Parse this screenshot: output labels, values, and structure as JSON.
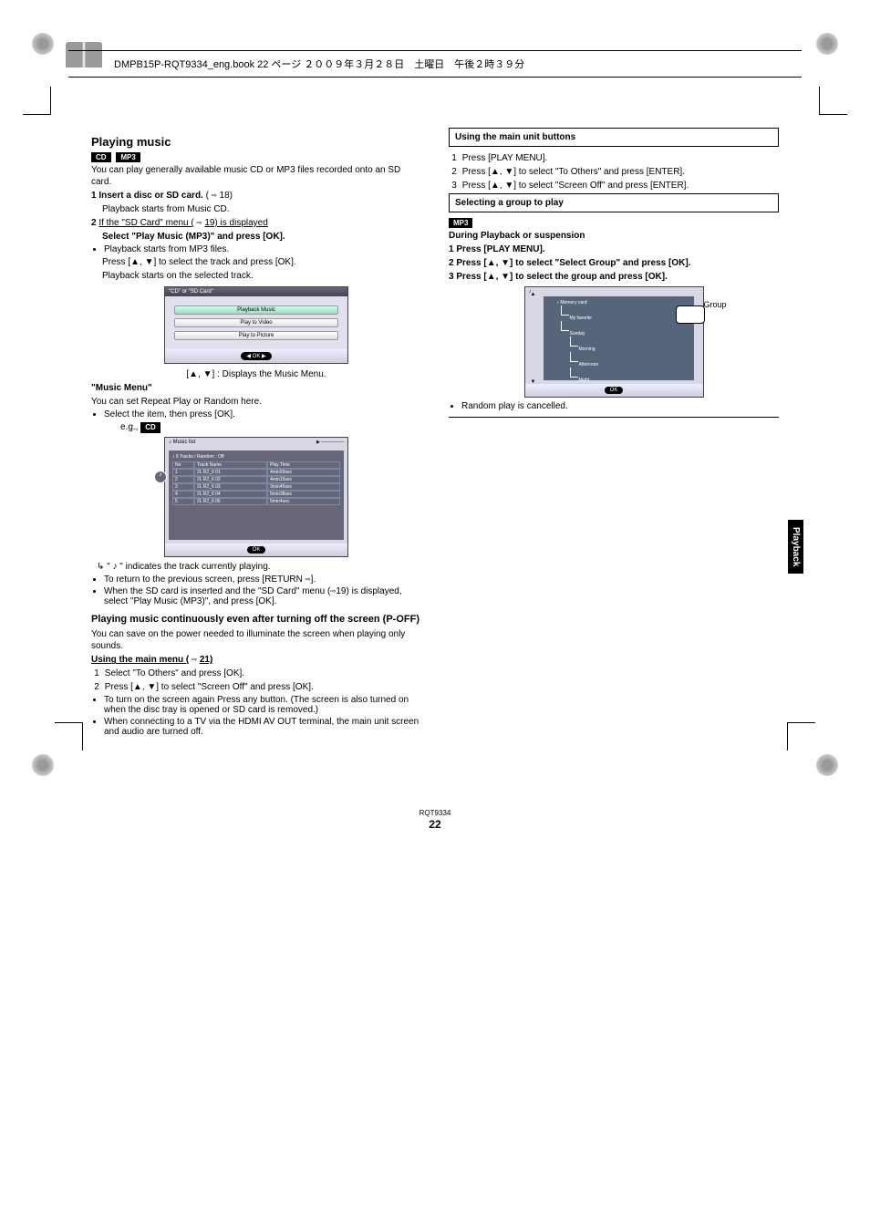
{
  "header": "DMPB15P-RQT9334_eng.book  22 ページ  ２００９年３月２８日　土曜日　午後２時３９分",
  "left": {
    "title": "Playing music",
    "intro": "You can play generally available music CD or MP3 files recorded onto an SD card.",
    "step1_label": "1",
    "step1_bold": "Insert a disc or SD card.",
    "step1_after": "(",
    "step1_ref": "18)",
    "step1_note": "Playback starts from Music CD.",
    "step2_label": "2",
    "step2_intro": "If the \"SD Card\" menu (",
    "step2_ref": "19) is displayed",
    "step2_bold": "Select \"Play Music (MP3)\" and press [OK].",
    "bul1": "Playback starts from MP3 files.",
    "step2_cont": "Press [▲, ▼] to select the track and press [OK].",
    "step2_note": "Playback starts on the selected track.",
    "menu_title": "\"CD\" or \"SD Card\"",
    "menu_btn1": "Playback Music",
    "menu_btn2": "Play to Video",
    "menu_btn3": "Play to Picture",
    "menu_arrows": "[▲, ▼] : Displays the Music Menu.",
    "music_title": "\"Music Menu\"",
    "music_intro": "You can set Repeat Play or Random here.",
    "bul2": "Select the item, then press [OK].",
    "eg_pre": "e.g., ",
    "popup_title": "Music list",
    "popup_header": "5 Tracks / Random : Off",
    "col_no": "No",
    "col_track": "Track Name",
    "col_time": "Play Time",
    "r1n": "1",
    "r1t": "2L R2_6 01",
    "r1p": "4min59sec",
    "r2n": "2",
    "r2t": "2L R2_6 02",
    "r2p": "4min15sec",
    "r3n": "3",
    "r3t": "2L R2_6 03",
    "r3p": "3min45sec",
    "r4n": "4",
    "r4t": "2L R2_6 04",
    "r4p": "5min38sec",
    "r5n": "5",
    "r5t": "2L R2_6 05",
    "r5p": "5min4sec",
    "playing_label": "\" ♪ \" indicates the track currently playing.",
    "bul3a": "To return to the previous screen, press [RETURN ",
    "bul3b": "].",
    "bul4a": "When the SD card is inserted and the \"SD Card\" menu (",
    "bul4b": "19) is displayed, select \"Play Music (MP3)\", and press [OK].",
    "screenoff": "Playing music continuously even after turning off the screen (P-OFF)",
    "screenoff_text": "You can save on the power needed to illuminate the screen when playing only sounds.",
    "pm_title": "Using the main menu (",
    "pm_ref": "21)",
    "sA_n": "1",
    "sA": "Select \"To Others\" and press [OK].",
    "sB_n": "2",
    "sB": "Press [▲, ▼] to select \"Screen Off\" and press [OK].",
    "note1": "To turn on the screen again Press any button. (The screen is also turned on when the disc tray is opened or SD card is removed.)",
    "note2": "When connecting to a TV via the HDMI AV OUT terminal, the main unit screen and audio are turned off."
  },
  "right": {
    "box1_title": "Using the main unit buttons",
    "b1_n": "1",
    "b1": "Press [PLAY MENU].",
    "b2_n": "2",
    "b2": "Press [▲, ▼] to select \"To Others\" and press [ENTER].",
    "b3_n": "3",
    "b3": "Press [▲, ▼] to select \"Screen Off\" and press [ENTER].",
    "box2_title": "Selecting a group to play",
    "r_intro": "During Playback or suspension",
    "s1_label": "1",
    "s1_bold": "Press [PLAY MENU].",
    "s2_label": "2",
    "s2a": "Press [▲, ▼] to select \"Select Group\" and press [OK].",
    "s3_label": "3",
    "s3a": "Press [▲, ▼] to select the group and press [OK].",
    "tree_title": "Memory card",
    "t1": "My favorite",
    "t2": "Sunday",
    "t3": "Morning",
    "t4": "Afternoon",
    "t5": "Night",
    "group_label": "Group",
    "bul_last": "Random play is cancelled."
  },
  "side_tab": "Playback",
  "page_ref": "RQT9334",
  "page_num": "22"
}
